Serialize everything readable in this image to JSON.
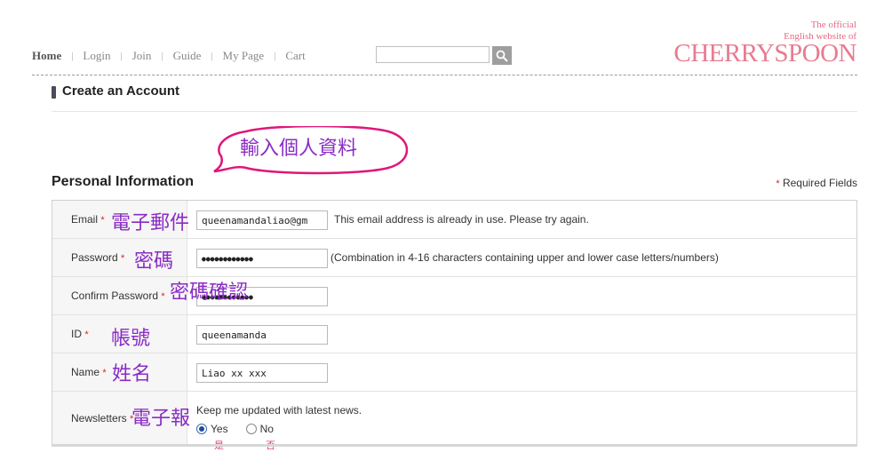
{
  "nav": {
    "items": [
      "Home",
      "Login",
      "Join",
      "Guide",
      "My Page",
      "Cart"
    ],
    "separator": "|"
  },
  "search": {
    "value": "",
    "button_icon": "search-icon"
  },
  "logo": {
    "tag_line1": "The official",
    "tag_line2": "English website of",
    "brand": "CHERRYSPOON"
  },
  "page": {
    "title": "Create an Account"
  },
  "annotation": {
    "bubble_text": "輸入個人資料"
  },
  "section": {
    "title": "Personal Information",
    "required_note": "Required Fields",
    "required_mark": "*"
  },
  "form": {
    "email": {
      "label": "Email",
      "value": "queenamandaliao@gm",
      "hint": "This email address is already in use. Please try again.",
      "annotation": "電子郵件"
    },
    "password": {
      "label": "Password",
      "value": "●●●●●●●●●●●●",
      "hint": "(Combination in 4-16 characters containing upper and lower case letters/numbers)",
      "annotation": "密碼"
    },
    "confirm": {
      "label": "Confirm Password",
      "value": "●●●●●●●●●●●●",
      "annotation": "密碼確認"
    },
    "id": {
      "label": "ID",
      "value": "queenamanda",
      "annotation": "帳號"
    },
    "name": {
      "label": "Name",
      "value": "Liao xx xxx",
      "annotation": "姓名"
    },
    "newsletters": {
      "label": "Newsletters",
      "text": "Keep me updated with latest news.",
      "annotation": "電子報",
      "options": [
        "Yes",
        "No"
      ],
      "selected": "Yes",
      "option_annotations": [
        "是",
        "否"
      ]
    }
  },
  "colors": {
    "brand": "#e87b90",
    "annotation": "#8a2cc4",
    "bubble": "#e0167a",
    "required": "#d8242a"
  }
}
